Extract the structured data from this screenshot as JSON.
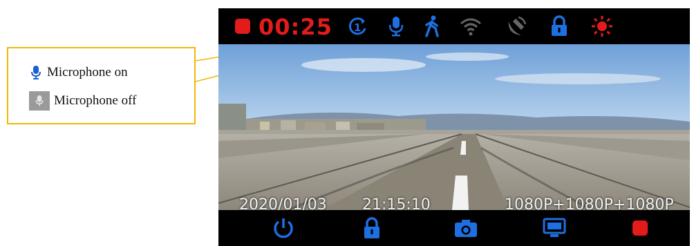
{
  "callout": {
    "mic_on_label": "Microphone on",
    "mic_off_label": "Microphone off",
    "border_color": "#f2b705"
  },
  "status_bar": {
    "record_indicator": "record-dot-icon",
    "timer": "00:25",
    "icons": [
      "loop-recording-icon",
      "microphone-icon",
      "motion-detection-icon",
      "wifi-icon",
      "gps-icon",
      "lock-icon",
      "brightness-icon"
    ]
  },
  "video_overlay": {
    "date": "2020/01/03",
    "time": "21:15:10",
    "resolution": "1080P+1080P+1080P"
  },
  "bottom_bar": {
    "icons": [
      "power-icon",
      "lock-icon",
      "camera-icon",
      "screen-icon",
      "record-stop-icon"
    ]
  },
  "colors": {
    "record_red": "#e31b1b",
    "icon_blue": "#1e6fe0",
    "icon_gray": "#666666"
  }
}
